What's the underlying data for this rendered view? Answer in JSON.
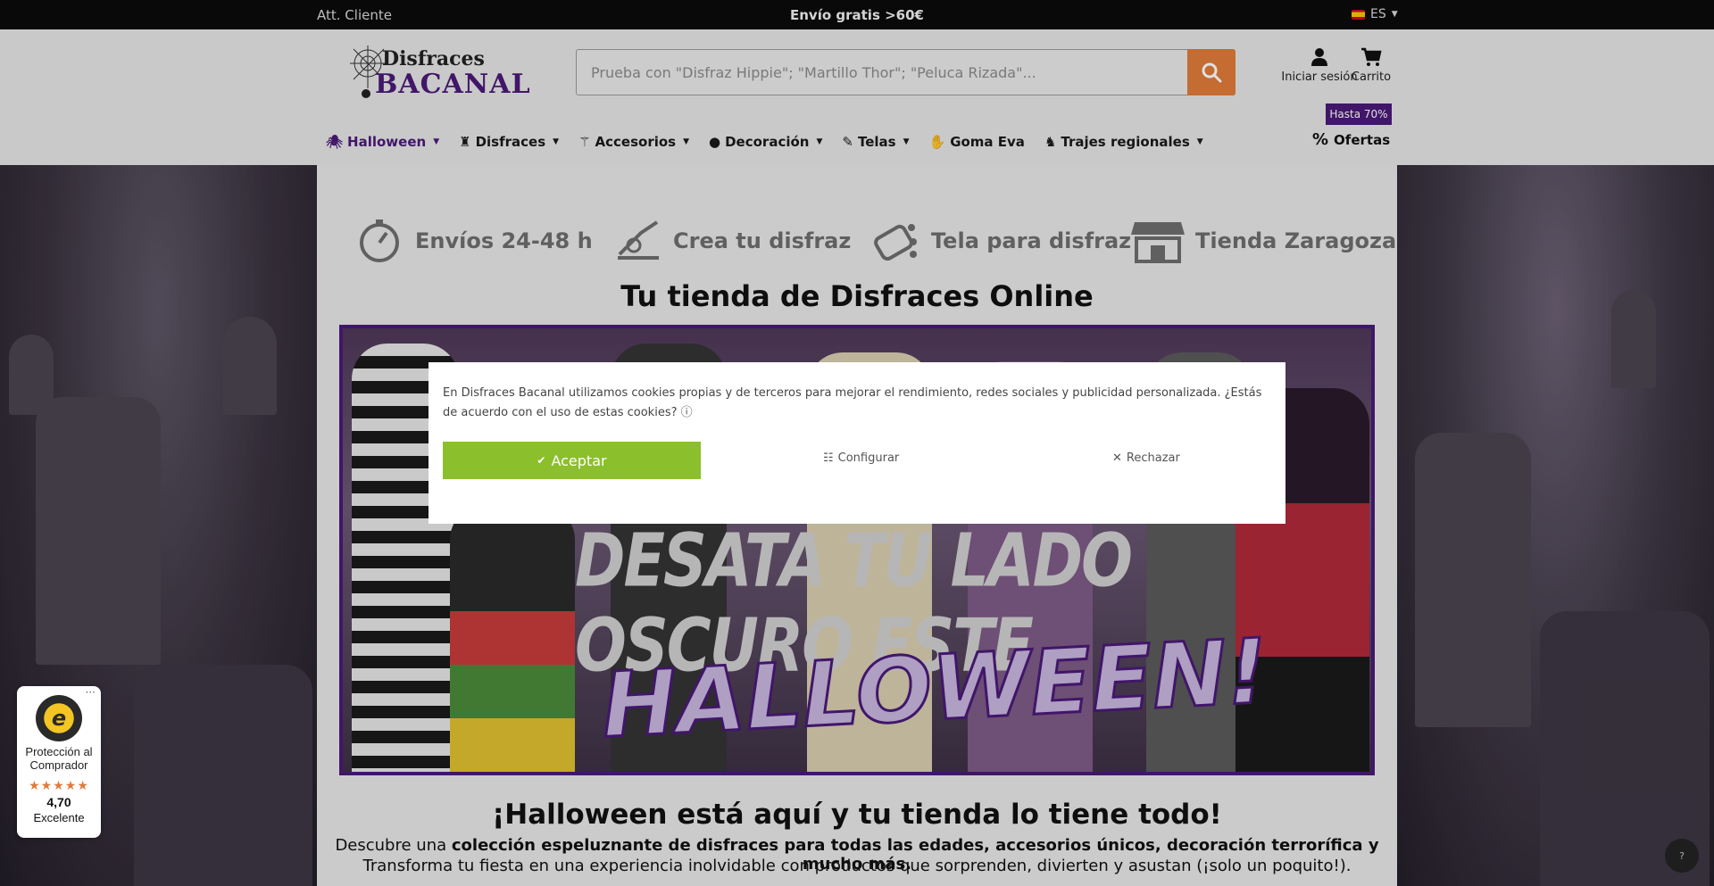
{
  "topbar": {
    "customer_service": "Att. Cliente",
    "shipping": "Envío gratis >60€",
    "lang": "ES"
  },
  "header": {
    "logo_top": "Disfraces",
    "logo_bottom": "BACANAL",
    "search_placeholder": "Prueba con \"Disfraz Hippie\"; \"Martillo Thor\"; \"Peluca Rizada\"...",
    "login": "Iniciar sesión",
    "cart": "Carrito",
    "promo": "Hasta 70%"
  },
  "nav": {
    "items": [
      "Halloween",
      "Disfraces",
      "Accesorios",
      "Decoración",
      "Telas",
      "Goma Eva",
      "Trajes regionales"
    ],
    "offers": "Ofertas"
  },
  "features": [
    "Envíos 24-48 h",
    "Crea tu disfraz",
    "Tela para disfraz",
    "Tienda Zaragoza"
  ],
  "main": {
    "title": "Tu tienda de Disfraces Online",
    "banner_line1": "DESATA TU LADO OSCURO ESTE",
    "banner_line2": "HALLOWEEN!",
    "subtitle": "¡Halloween está aquí y tu tienda lo tiene todo!",
    "text1_pre": "Descubre una ",
    "text1_bold": "colección espeluznante de disfraces para todas las edades, accesorios únicos, decoración terrorífica y mucho más.",
    "text2": "Transforma tu fiesta en una experiencia inolvidable con productos que sorprenden, divierten y asustan (¡solo un poquito!)."
  },
  "cookie": {
    "text": "En Disfraces Bacanal utilizamos cookies propias y de terceros para mejorar el rendimiento, redes sociales y publicidad personalizada. ¿Estás de acuerdo con el uso de estas cookies? ⓘ",
    "accept": "Aceptar",
    "configure": "Configurar",
    "reject": "Rechazar"
  },
  "trust": {
    "label": "Protección al Comprador",
    "score": "4,70",
    "rating": "Excelente",
    "stars": "★★★★★"
  },
  "colors": {
    "accent": "#4a1a78",
    "search_btn": "#e07b39",
    "accept": "#8bbf2c"
  }
}
